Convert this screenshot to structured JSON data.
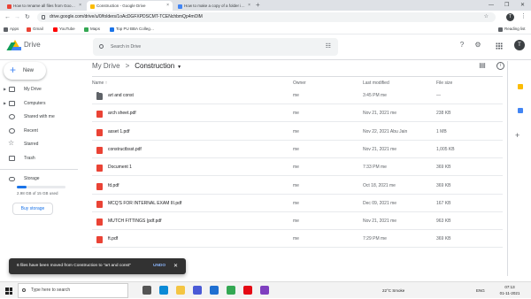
{
  "browser": {
    "tabs": [
      {
        "label": "How to rename all files from Goo…",
        "color": "#ea4335"
      },
      {
        "label": "Construction - Google Drive",
        "color": "#fbbc04"
      },
      {
        "label": "How to make a copy of a folder i…",
        "color": "#4285f4"
      }
    ],
    "url": "drive.google.com/drive/u/0/folders/1oAcDGFXPDSCMT-TCENchbmQp4mOlM",
    "bookmarks": [
      {
        "label": "Apps",
        "color": "#5f6368"
      },
      {
        "label": "Gmail",
        "color": "#ea4335"
      },
      {
        "label": "YouTube",
        "color": "#ff0000"
      },
      {
        "label": "Maps",
        "color": "#34a853"
      },
      {
        "label": "Top PU BBA Colleg…",
        "color": "#1a73e8"
      }
    ],
    "reading_list": "Reading list",
    "profile_initial": "T"
  },
  "header": {
    "app_name": "Drive",
    "search_placeholder": "Search in Drive",
    "avatar_initial": "T"
  },
  "sidebar": {
    "new_label": "New",
    "items": [
      {
        "label": "My Drive"
      },
      {
        "label": "Computers"
      },
      {
        "label": "Shared with me"
      },
      {
        "label": "Recent"
      },
      {
        "label": "Starred"
      },
      {
        "label": "Trash"
      }
    ],
    "storage_label": "Storage",
    "storage_used_text": "2.98 GB of 15 GB used",
    "storage_fraction": 0.2,
    "buy_storage_label": "Buy storage"
  },
  "main": {
    "breadcrumb_root": "My Drive",
    "breadcrumb_separator": ">",
    "breadcrumb_current": "Construction",
    "columns": {
      "name": "Name",
      "owner": "Owner",
      "last_modified": "Last modified",
      "file_size": "File size"
    },
    "files": [
      {
        "name": "art and const",
        "type": "folder",
        "owner": "me",
        "modified": "3:45 PM me",
        "size": "—"
      },
      {
        "name": "arch sheet.pdf",
        "type": "pdf",
        "owner": "me",
        "modified": "Nov 21, 2021 me",
        "size": "238 KB"
      },
      {
        "name": "asset 1.pdf",
        "type": "pdf",
        "owner": "me",
        "modified": "Nov 22, 2021 Abu Jain",
        "size": "1 MB"
      },
      {
        "name": "constructbsst.pdf",
        "type": "pdf",
        "owner": "me",
        "modified": "Nov 21, 2021 me",
        "size": "1,005 KB"
      },
      {
        "name": "Document 1",
        "type": "pdf",
        "owner": "me",
        "modified": "7:33 PM me",
        "size": "369 KB"
      },
      {
        "name": "fd.pdf",
        "type": "pdf",
        "owner": "me",
        "modified": "Oct 18, 2021 me",
        "size": "369 KB"
      },
      {
        "name": "MCQ'S FOR INTERNAL EXAM III.pdf",
        "type": "pdf",
        "owner": "me",
        "modified": "Dec 09, 2021 me",
        "size": "167 KB"
      },
      {
        "name": "MUTCH FITTINGS (pdf.pdf",
        "type": "pdf",
        "owner": "me",
        "modified": "Nov 21, 2021 me",
        "size": "963 KB"
      },
      {
        "name": "ft.pdf",
        "type": "pdf",
        "owner": "me",
        "modified": "7:29 PM me",
        "size": "369 KB"
      }
    ]
  },
  "snackbar": {
    "message": "6 files have been moved from Construction to \"art and const\"",
    "undo": "UNDO"
  },
  "taskbar": {
    "search_placeholder": "Type here to search",
    "weather": "22°C  Smoke",
    "language": "ENG",
    "time": "07:13",
    "date": "01-11-2021",
    "apps": [
      {
        "name": "task-view",
        "color": "#555555"
      },
      {
        "name": "edge",
        "color": "#0b8ad6"
      },
      {
        "name": "file-explorer",
        "color": "#f4c542"
      },
      {
        "name": "store",
        "color": "#4a5ad6"
      },
      {
        "name": "mail",
        "color": "#1f6fd1"
      },
      {
        "name": "chrome",
        "color": "#34a853"
      },
      {
        "name": "netflix",
        "color": "#e50914"
      },
      {
        "name": "media",
        "color": "#7f3fbf"
      }
    ]
  },
  "colors": {
    "accent": "#1a73e8",
    "pdf": "#ea4335"
  }
}
